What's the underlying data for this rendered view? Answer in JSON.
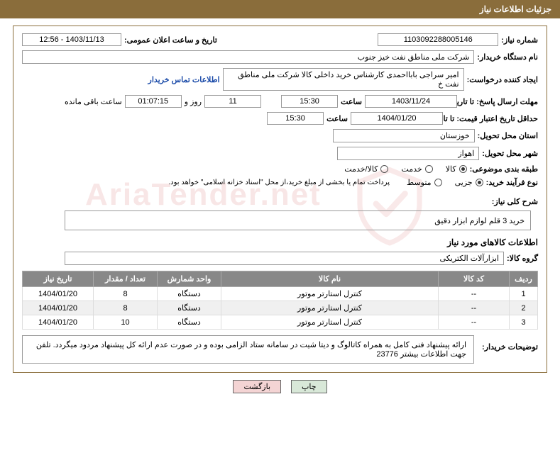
{
  "header": {
    "title": "جزئیات اطلاعات نیاز"
  },
  "fields": {
    "need_number_label": "شماره نیاز:",
    "need_number": "1103092288005146",
    "announce_date_label": "تاریخ و ساعت اعلان عمومی:",
    "announce_date": "1403/11/13 - 12:56",
    "buyer_org_label": "نام دستگاه خریدار:",
    "buyer_org": "شرکت ملی مناطق نفت خیز جنوب",
    "requester_label": "ایجاد کننده درخواست:",
    "requester": "امیر سراجی بابااحمدی کارشناس خرید داخلی کالا شرکت ملی مناطق نفت خ",
    "contact_link": "اطلاعات تماس خریدار",
    "deadline_label": "مهلت ارسال پاسخ: تا تاریخ:",
    "deadline_date": "1403/11/24",
    "time_label": "ساعت",
    "deadline_time": "15:30",
    "days_count": "11",
    "days_and": "روز و",
    "hours_count": "01:07:15",
    "remaining_label": "ساعت باقی مانده",
    "validity_label": "حداقل تاریخ اعتبار قیمت: تا تاریخ:",
    "validity_date": "1404/01/20",
    "validity_time": "15:30",
    "province_label": "استان محل تحویل:",
    "province": "خوزستان",
    "city_label": "شهر محل تحویل:",
    "city": "اهواز",
    "category_label": "طبقه بندی موضوعی:",
    "cat_goods": "کالا",
    "cat_service": "خدمت",
    "cat_both": "کالا/خدمت",
    "process_label": "نوع فرآیند خرید:",
    "proc_partial": "جزیی",
    "proc_medium": "متوسط",
    "payment_note": "پرداخت تمام یا بخشی از مبلغ خرید،از محل \"اسناد خزانه اسلامی\" خواهد بود.",
    "need_desc_label": "شرح کلی نیاز:",
    "need_desc": "خرید 3 قلم لوازم ابزار دقیق",
    "items_section": "اطلاعات کالاهای مورد نیاز",
    "group_label": "گروه کالا:",
    "group_value": "ابزارآلات الکتریکی",
    "buyer_notes_label": "توضیحات خریدار:",
    "buyer_notes": "ارائه پیشنهاد فنی کامل به همراه کاتالوگ و دیتا شیت در سامانه ستاد الزامی بوده و در صورت عدم ارائه کل پیشنهاد مردود میگردد. تلفن جهت اطلاعات بیشتر 23776"
  },
  "table": {
    "headers": {
      "row": "ردیف",
      "code": "کد کالا",
      "name": "نام کالا",
      "unit": "واحد شمارش",
      "qty": "تعداد / مقدار",
      "need_date": "تاریخ نیاز"
    },
    "rows": [
      {
        "row": "1",
        "code": "--",
        "name": "کنترل استارتر موتور",
        "unit": "دستگاه",
        "qty": "8",
        "need_date": "1404/01/20"
      },
      {
        "row": "2",
        "code": "--",
        "name": "کنترل استارتر موتور",
        "unit": "دستگاه",
        "qty": "8",
        "need_date": "1404/01/20"
      },
      {
        "row": "3",
        "code": "--",
        "name": "کنترل استارتر موتور",
        "unit": "دستگاه",
        "qty": "10",
        "need_date": "1404/01/20"
      }
    ]
  },
  "buttons": {
    "print": "چاپ",
    "back": "بازگشت"
  },
  "watermark": "AriaTender.net"
}
